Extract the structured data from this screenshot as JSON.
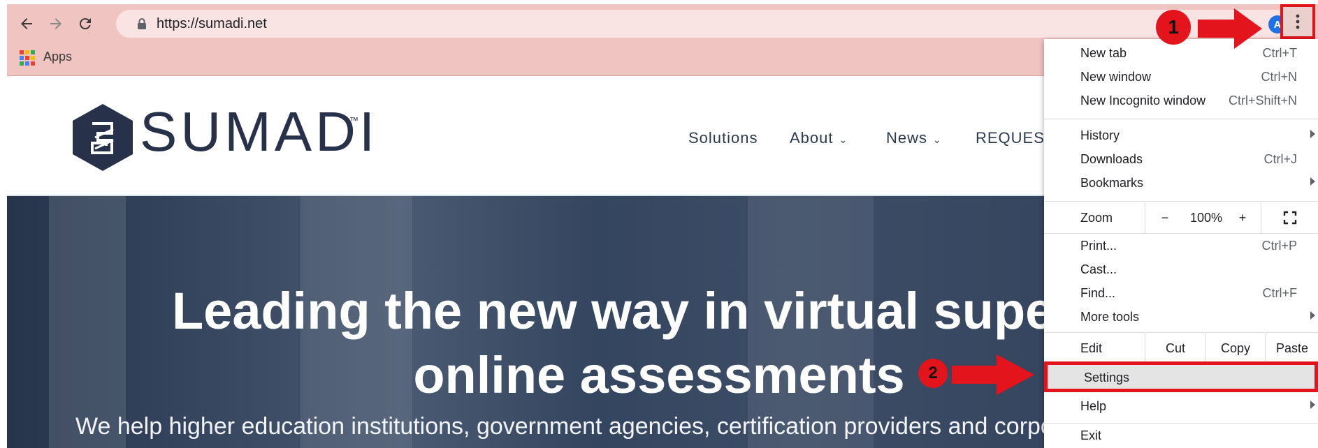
{
  "browser": {
    "url": "https://sumadi.net",
    "avatar_letter": "A",
    "bookmarks_apps_label": "Apps"
  },
  "site": {
    "logo_text": "SUMADI",
    "logo_tm": "™",
    "nav": [
      {
        "label": "Solutions"
      },
      {
        "label": "About"
      },
      {
        "label": "News"
      },
      {
        "label": "REQUEST"
      }
    ],
    "headline_line1": "Leading the new way in virtual supervis",
    "headline_line2": "online assessments",
    "subtext": "We help higher education institutions, government agencies, certification providers and corpo"
  },
  "menu": {
    "new_tab": {
      "label": "New tab",
      "shortcut": "Ctrl+T"
    },
    "new_window": {
      "label": "New window",
      "shortcut": "Ctrl+N"
    },
    "new_incognito": {
      "label": "New Incognito window",
      "shortcut": "Ctrl+Shift+N"
    },
    "history": {
      "label": "History"
    },
    "downloads": {
      "label": "Downloads",
      "shortcut": "Ctrl+J"
    },
    "bookmarks": {
      "label": "Bookmarks"
    },
    "zoom": {
      "label": "Zoom",
      "minus": "−",
      "value": "100%",
      "plus": "+"
    },
    "print": {
      "label": "Print...",
      "shortcut": "Ctrl+P"
    },
    "cast": {
      "label": "Cast..."
    },
    "find": {
      "label": "Find...",
      "shortcut": "Ctrl+F"
    },
    "more_tools": {
      "label": "More tools"
    },
    "edit": {
      "label": "Edit",
      "cut": "Cut",
      "copy": "Copy",
      "paste": "Paste"
    },
    "settings": {
      "label": "Settings"
    },
    "help": {
      "label": "Help"
    },
    "exit": {
      "label": "Exit"
    }
  },
  "annotations": {
    "step1": "1",
    "step2": "2"
  },
  "colors": {
    "highlight_red": "#e3141c",
    "chrome_tint": "#f0c4c1",
    "brand_navy": "#27324a"
  }
}
